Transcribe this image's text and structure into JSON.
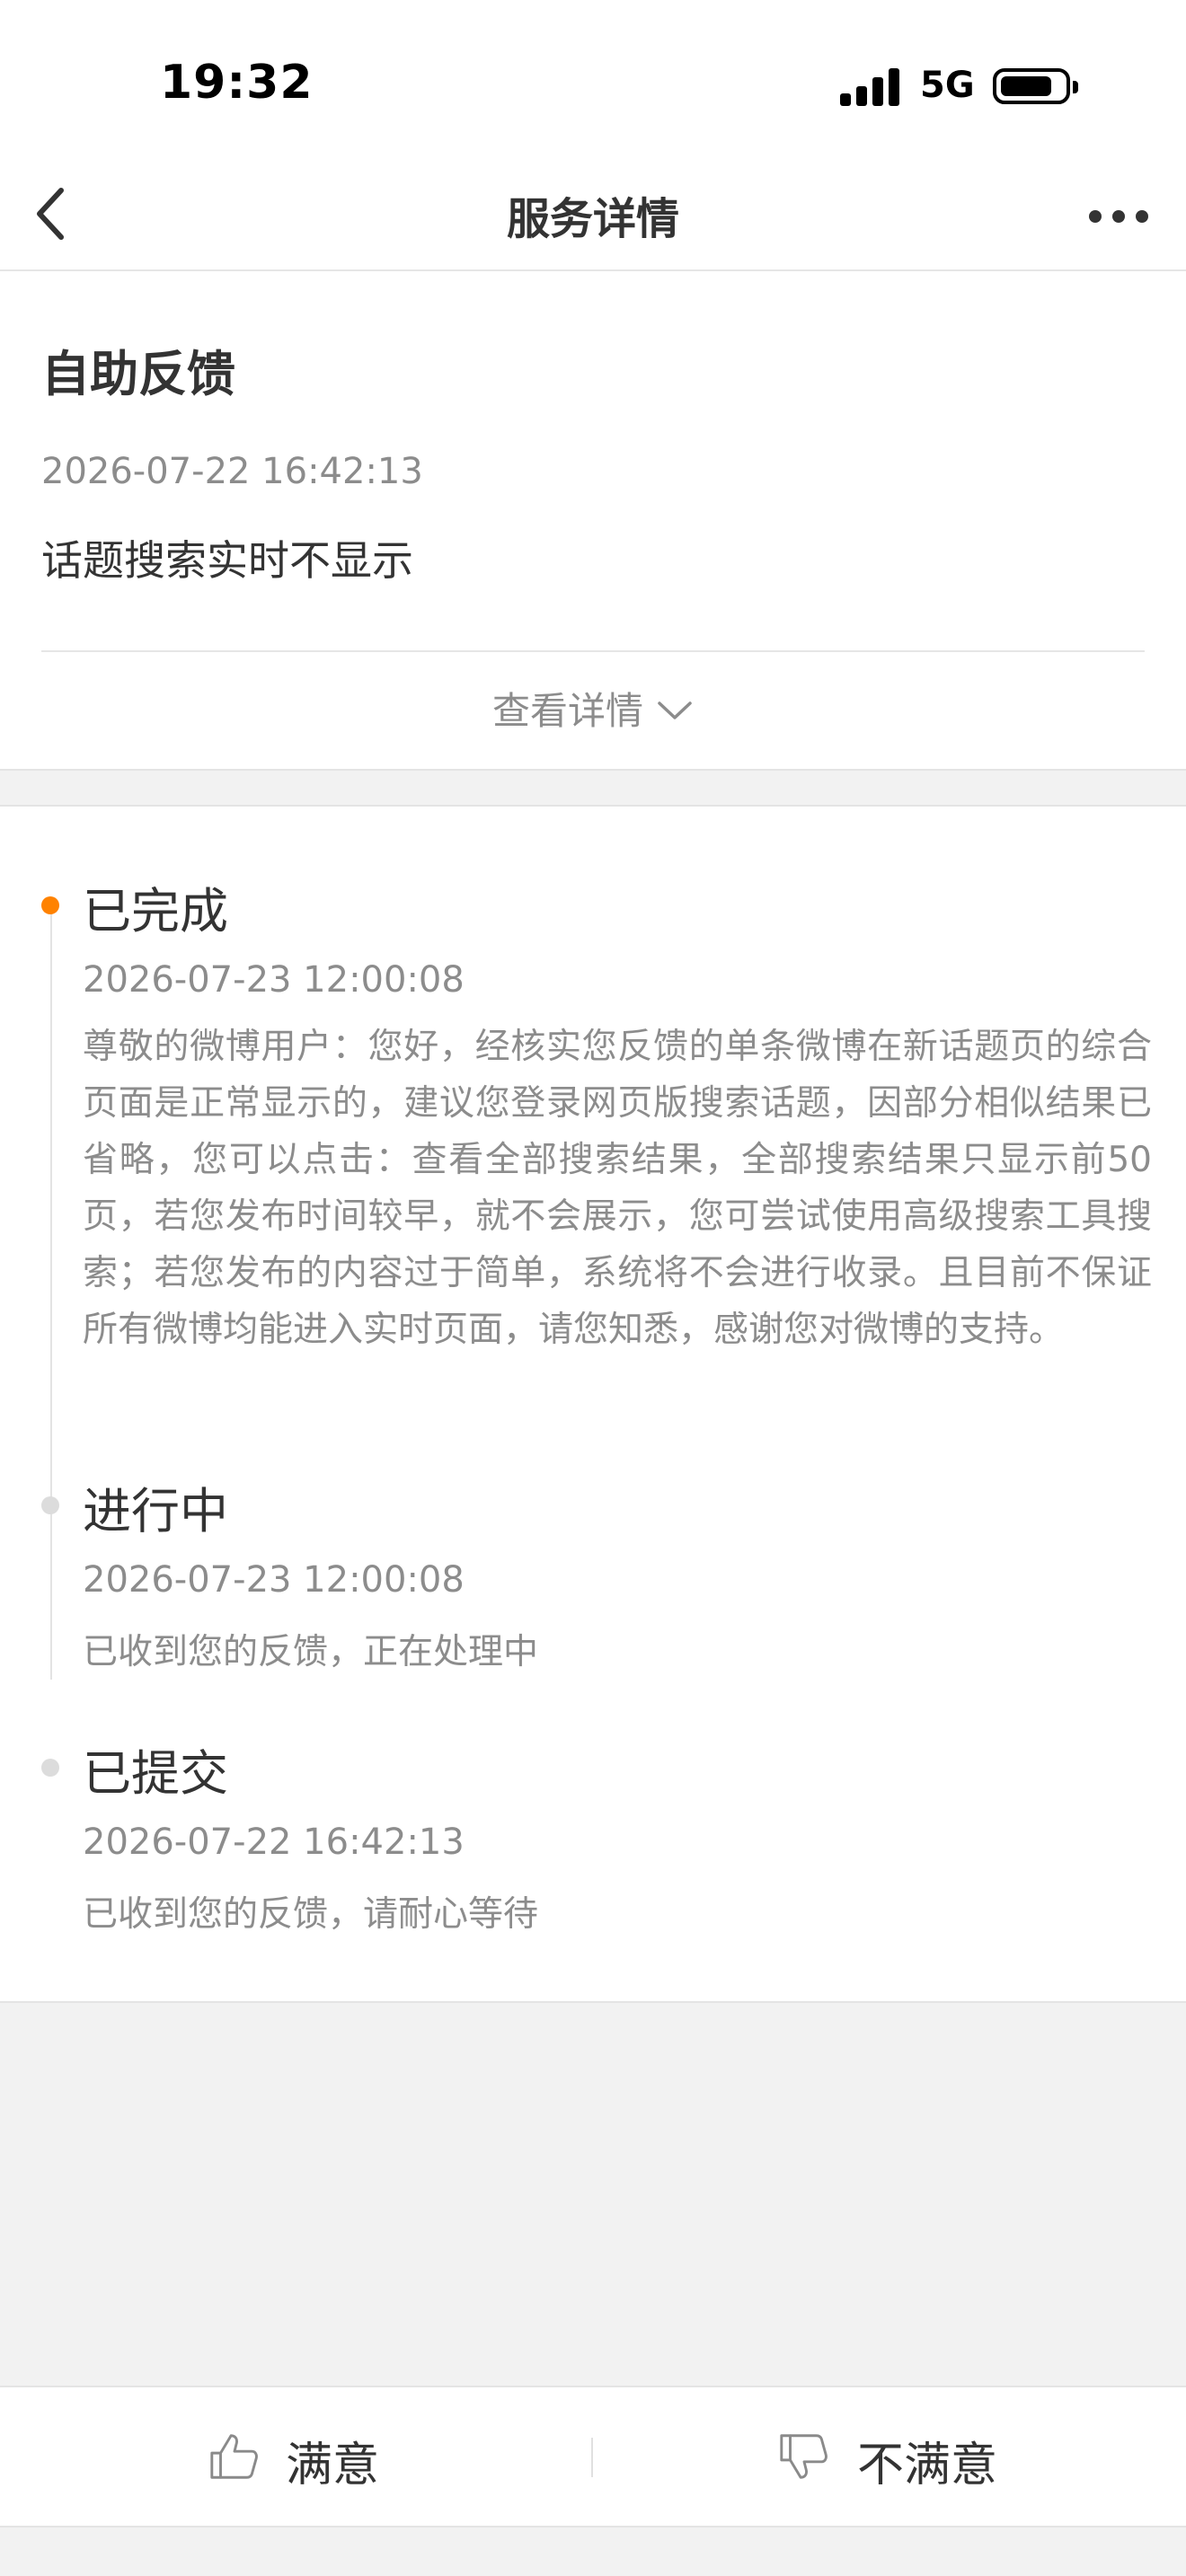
{
  "status_bar": {
    "time": "19:32",
    "network": "5G"
  },
  "nav": {
    "title": "服务详情"
  },
  "feedback": {
    "title": "自助反馈",
    "time": "2026-07-22 16:42:13",
    "content": "话题搜索实时不显示",
    "view_details_label": "查看详情"
  },
  "timeline": [
    {
      "title": "已完成",
      "time": "2026-07-23 12:00:08",
      "description": "尊敬的微博用户：您好，经核实您反馈的单条微博在新话题页的综合页面是正常显示的，建议您登录网页版搜索话题，因部分相似结果已省略，您可以点击：查看全部搜索结果，全部搜索结果只显示前50页，若您发布时间较早，就不会展示，您可尝试使用高级搜索工具搜索；若您发布的内容过于简单，系统将不会进行收录。且目前不保证所有微博均能进入实时页面，请您知悉，感谢您对微博的支持。",
      "active": true
    },
    {
      "title": "进行中",
      "time": "2026-07-23 12:00:08",
      "description": "已收到您的反馈，正在处理中",
      "active": false
    },
    {
      "title": "已提交",
      "time": "2026-07-22 16:42:13",
      "description": "已收到您的反馈，请耐心等待",
      "active": false
    }
  ],
  "rating": {
    "satisfied_label": "满意",
    "unsatisfied_label": "不满意"
  },
  "colors": {
    "accent": "#ff8200",
    "text_primary": "#333333",
    "text_secondary": "#8c8c8c"
  },
  "icons": {
    "back": "chevron-left-icon",
    "more": "more-dots-icon",
    "expand": "chevron-down-icon",
    "satisfied": "thumbs-up-icon",
    "unsatisfied": "thumbs-down-icon"
  }
}
